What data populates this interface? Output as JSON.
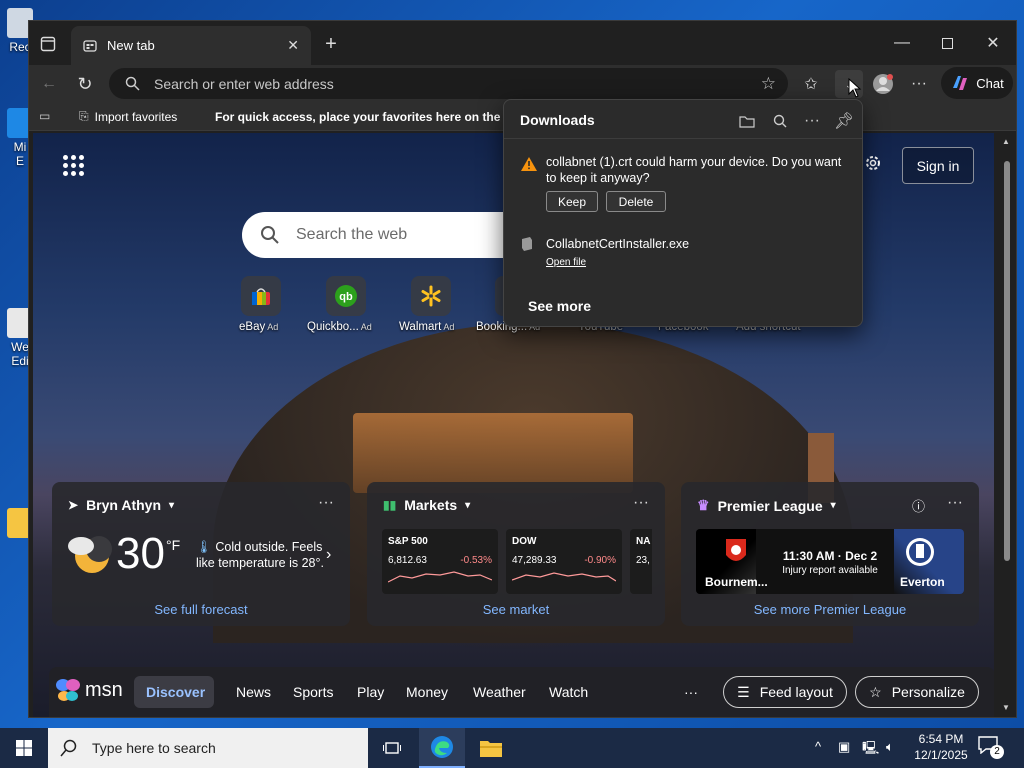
{
  "desktop": {
    "icons": [
      {
        "label": "Rec",
        "color": "#cfd8e3"
      },
      {
        "label": "Mi\nE",
        "color": "#1e88e5"
      },
      {
        "label": "We\nEdi",
        "color": "#e8e8e8"
      },
      {
        "label": "",
        "color": "#f5c542"
      }
    ]
  },
  "browser": {
    "tab_title": "New tab",
    "address_placeholder": "Search or enter web address",
    "chat_label": "Chat",
    "favorites": {
      "import_label": "Import favorites",
      "hint": "For quick access, place your favorites here on the fav"
    }
  },
  "downloads": {
    "title": "Downloads",
    "warning_text": "collabnet (1).crt could harm your device. Do you want to keep it anyway?",
    "keep_label": "Keep",
    "delete_label": "Delete",
    "file_name": "CollabnetCertInstaller.exe",
    "open_file_label": "Open file",
    "see_more_label": "See more"
  },
  "newtab": {
    "sign_in_label": "Sign in",
    "search_placeholder": "Search the web",
    "tiles": [
      {
        "label": "eBay",
        "ad": "Ad"
      },
      {
        "label": "Quickbo...",
        "ad": "Ad"
      },
      {
        "label": "Walmart",
        "ad": "Ad"
      },
      {
        "label": "Booking...",
        "ad": "Ad"
      },
      {
        "label": "YouTube",
        "ad": ""
      },
      {
        "label": "Facebook",
        "ad": ""
      },
      {
        "label": "Add shortcut",
        "ad": ""
      }
    ],
    "weather": {
      "location": "Bryn Athyn",
      "temp": "30",
      "unit": "°F",
      "note": "Cold outside. Feels like temperature is 28°.",
      "link": "See full forecast"
    },
    "markets": {
      "title": "Markets",
      "link": "See market",
      "items": [
        {
          "name": "S&P 500",
          "value": "6,812.63",
          "change": "-0.53%"
        },
        {
          "name": "DOW",
          "value": "47,289.33",
          "change": "-0.90%"
        },
        {
          "name": "NA",
          "value": "23,",
          "change": ""
        }
      ]
    },
    "league": {
      "title": "Premier League",
      "time": "11:30 AM · Dec 2",
      "note": "Injury report available",
      "home": "Bournem...",
      "away": "Everton",
      "link": "See more Premier League"
    },
    "msn": {
      "logo": "msn",
      "nav": [
        "Discover",
        "News",
        "Sports",
        "Play",
        "Money",
        "Weather",
        "Watch"
      ],
      "more": "···",
      "feed_layout": "Feed layout",
      "personalize": "Personalize"
    }
  },
  "taskbar": {
    "search_placeholder": "Type here to search",
    "time": "6:54 PM",
    "date": "12/1/2025",
    "notification_count": "2"
  }
}
